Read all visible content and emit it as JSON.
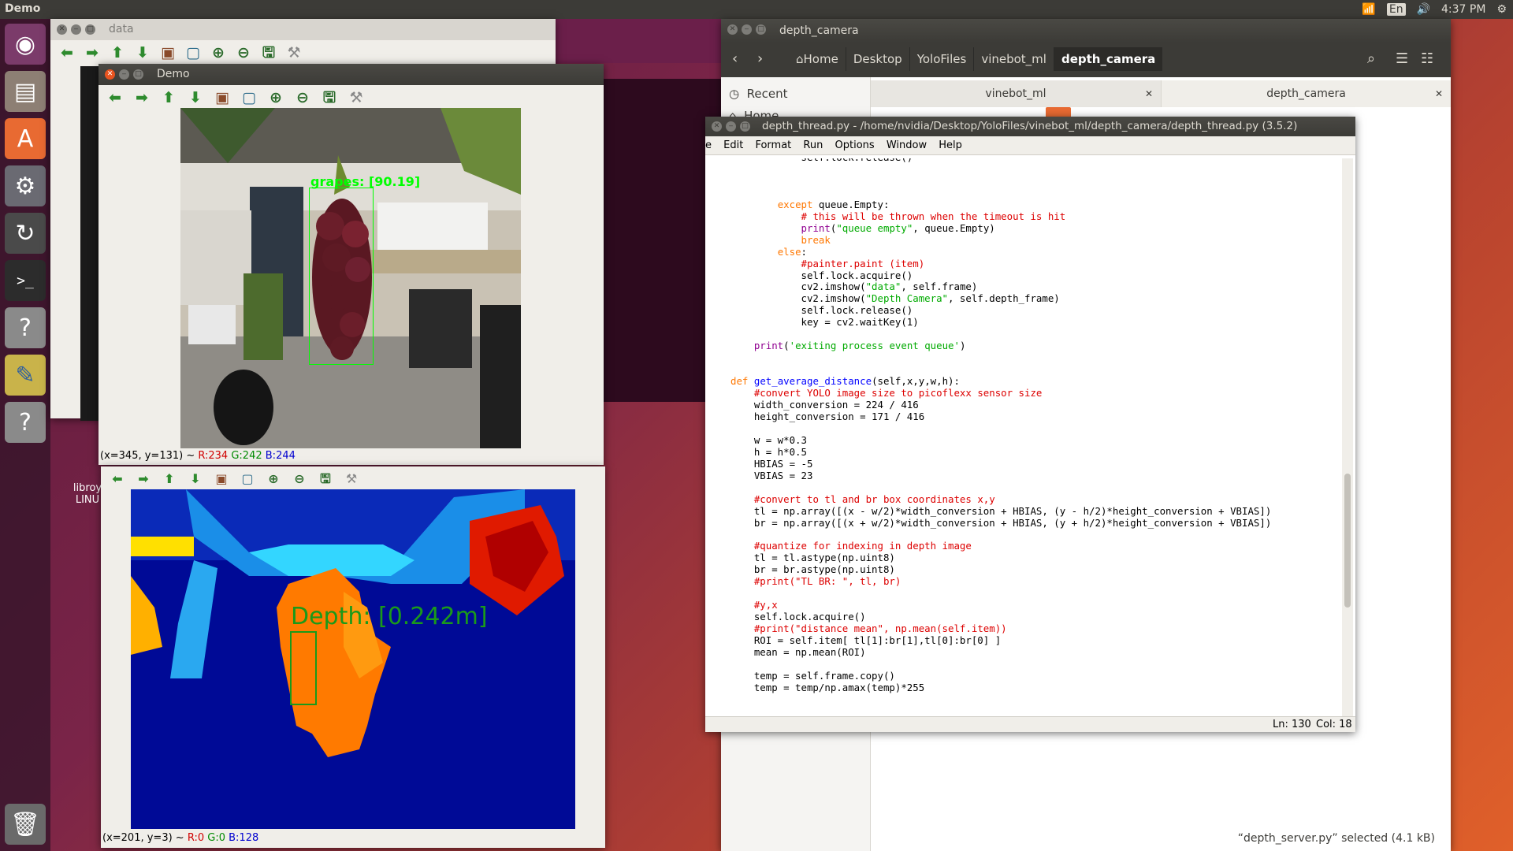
{
  "top_panel": {
    "app_name": "Demo",
    "keyboard": "En",
    "clock": "4:37 PM"
  },
  "launcher": {
    "items": [
      "ubuntu-dash",
      "files",
      "software-center",
      "system-settings",
      "software-updater",
      "terminal",
      "unknown-app",
      "python-idle",
      "unknown-app-2",
      "trash"
    ]
  },
  "desktop_icon": {
    "label_line1": "libroy",
    "label_line2": "LINU"
  },
  "data_window": {
    "title": "data"
  },
  "demo_window": {
    "title": "Demo",
    "detection_label": "grapes: [90.19]",
    "status": {
      "coords": "(x=345, y=131) ~ ",
      "r": "R:234",
      "g": "G:242",
      "b": "B:244"
    }
  },
  "depth_window": {
    "depth_label": "Depth: [0.242m]",
    "status": {
      "coords": "(x=201, y=3) ~ ",
      "r": "R:0",
      "g": "G:0",
      "b": "B:128"
    }
  },
  "file_manager": {
    "title": "depth_camera",
    "breadcrumbs": [
      "Home",
      "Desktop",
      "YoloFiles",
      "vinebot_ml",
      "depth_camera"
    ],
    "sidebar": {
      "recent": "Recent",
      "home": "Home"
    },
    "tabs": [
      "vinebot_ml",
      "depth_camera"
    ],
    "status": "“depth_server.py” selected (4.1 kB)"
  },
  "idle": {
    "title": "depth_thread.py - /home/nvidia/Desktop/YoloFiles/vinebot_ml/depth_camera/depth_thread.py (3.5.2)",
    "menu": [
      "e",
      "Edit",
      "Format",
      "Run",
      "Options",
      "Window",
      "Help"
    ],
    "status": {
      "ln": "Ln: 130",
      "col": "Col: 18"
    }
  },
  "colors": {
    "accent": "#e95420",
    "panel": "#3c3b37",
    "detect_green": "#00ff00"
  }
}
